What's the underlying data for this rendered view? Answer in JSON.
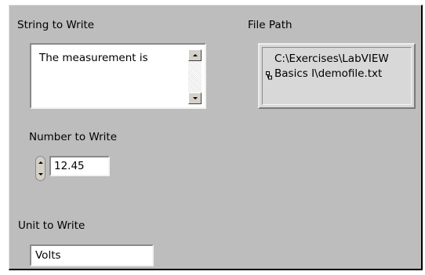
{
  "string_control": {
    "label": "String to Write",
    "value": "The measurement is"
  },
  "path_indicator": {
    "label": "File Path",
    "value": "C:\\Exercises\\LabVIEW\nBasics I\\demofile.txt"
  },
  "number_control": {
    "label": "Number to Write",
    "value": "12.45"
  },
  "unit_control": {
    "label": "Unit to Write",
    "value": "Volts"
  },
  "colors": {
    "panel_background": "#bdbdbd",
    "control_background": "#ffffff",
    "indicator_background": "#d8d8d8"
  }
}
